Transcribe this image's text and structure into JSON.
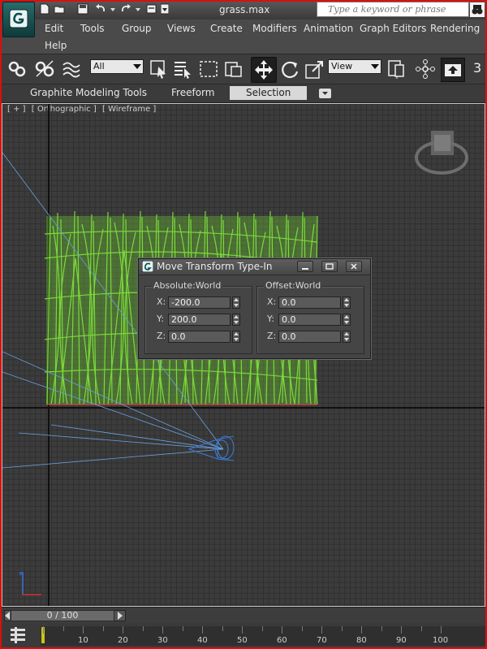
{
  "window": {
    "title": "grass.max"
  },
  "search": {
    "placeholder": "Type a keyword or phrase"
  },
  "menu": {
    "items": [
      "Edit",
      "Tools",
      "Group",
      "Views",
      "Create",
      "Modifiers",
      "Animation",
      "Graph Editors",
      "Rendering",
      "Help"
    ]
  },
  "toolbar": {
    "selection_filter": "All",
    "reference_coord": "View",
    "snap_label": "3"
  },
  "ribbon": {
    "tabs": [
      "Graphite Modeling Tools",
      "Freeform",
      "Selection"
    ],
    "active_tab": "Selection"
  },
  "viewport": {
    "labels": [
      "[ + ]",
      "[ Orthographic ]",
      "[ Wireframe ]"
    ]
  },
  "dialog": {
    "title": "Move Transform Type-In",
    "absolute": {
      "label": "Absolute:World",
      "x_label": "X:",
      "y_label": "Y:",
      "z_label": "Z:",
      "x": "-200.0",
      "y": "200.0",
      "z": "0.0"
    },
    "offset": {
      "label": "Offset:World",
      "x_label": "X:",
      "y_label": "Y:",
      "z_label": "Z:",
      "x": "0.0",
      "y": "0.0",
      "z": "0.0"
    }
  },
  "timeline": {
    "slider_text": "0 / 100",
    "ticks": [
      "10",
      "20",
      "30",
      "40",
      "50",
      "60",
      "70",
      "80",
      "90",
      "100"
    ]
  },
  "colors": {
    "grass": "#7ee03a",
    "viewport_bg": "#3c3c3c",
    "accent_red": "#d81010",
    "wire_blue": "#3a7bd8"
  }
}
